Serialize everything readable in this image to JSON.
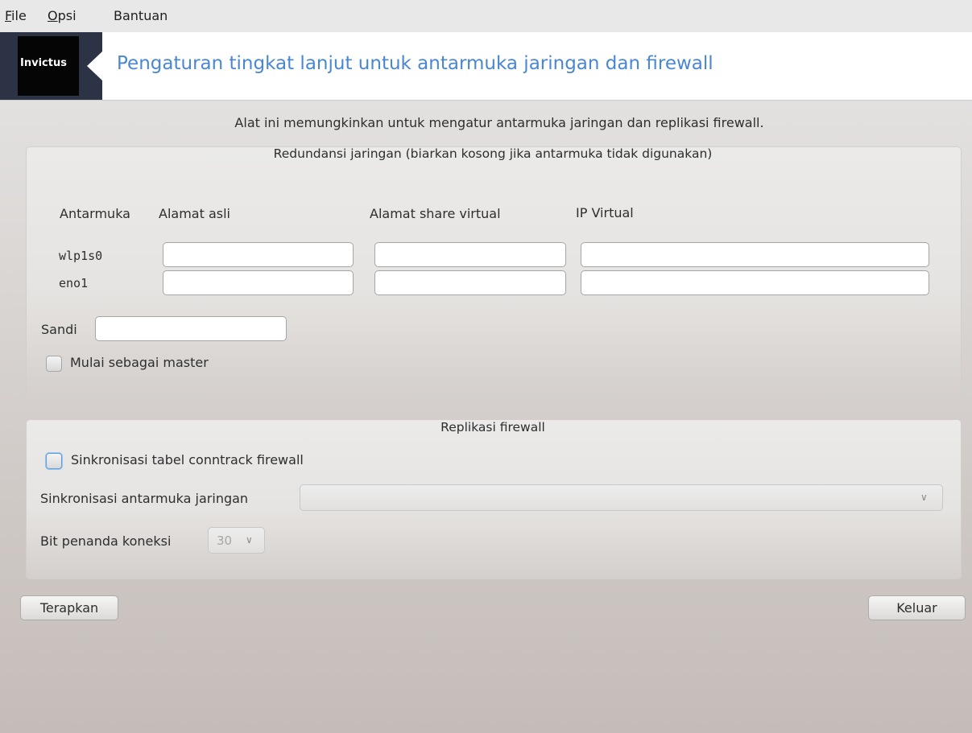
{
  "menu": {
    "items": [
      {
        "mnemonic": "F",
        "rest": "ile"
      },
      {
        "mnemonic": "O",
        "rest": "psi"
      },
      {
        "mnemonic": "",
        "rest": "Bantuan"
      }
    ]
  },
  "header": {
    "logo_text": "Invictus",
    "title": "Pengaturan tingkat lanjut untuk antarmuka jaringan dan firewall"
  },
  "intro": "Alat ini memungkinkan untuk mengatur antarmuka jaringan dan replikasi firewall.",
  "redundancy": {
    "title": "Redundansi jaringan (biarkan kosong jika antarmuka tidak digunakan)",
    "columns": [
      "Antarmuka",
      "Alamat asli",
      "Alamat share virtual",
      "IP Virtual"
    ],
    "rows": [
      {
        "interface": "wlp1s0",
        "real_address": "",
        "virtual_share": "",
        "virtual_ip": ""
      },
      {
        "interface": "eno1",
        "real_address": "",
        "virtual_share": "",
        "virtual_ip": ""
      }
    ],
    "password_label": "Sandi",
    "password_value": "",
    "master_label": "Mulai sebagai master",
    "master_checked": false
  },
  "replication": {
    "title": "Replikasi firewall",
    "sync_label": "Sinkronisasi tabel conntrack firewall",
    "sync_checked": false,
    "iface_label": "Sinkronisasi antarmuka jaringan",
    "iface_value": "",
    "bit_label": "Bit penanda koneksi",
    "bit_value": "30"
  },
  "buttons": {
    "apply": "Terapkan",
    "quit": "Keluar"
  }
}
